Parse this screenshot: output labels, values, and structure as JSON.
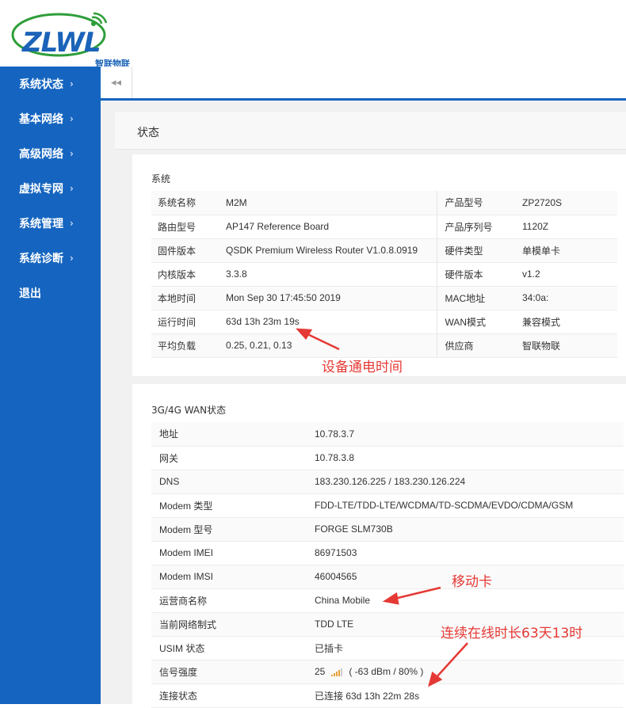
{
  "brand": {
    "logo_text": "ZLWL",
    "subtitle": "智联物联",
    "color": "#1a63b8"
  },
  "sidebar": {
    "color": "#1565c0",
    "items": [
      {
        "label": "系统状态",
        "icon": "chevron-right-icon"
      },
      {
        "label": "基本网络",
        "icon": "chevron-right-icon"
      },
      {
        "label": "高级网络",
        "icon": "chevron-right-icon"
      },
      {
        "label": "虚拟专网",
        "icon": "chevron-right-icon"
      },
      {
        "label": "系统管理",
        "icon": "chevron-right-icon"
      },
      {
        "label": "系统诊断",
        "icon": "chevron-right-icon"
      },
      {
        "label": "退出"
      }
    ]
  },
  "topbar": {
    "collapse_icon": "double-chevron-left-icon",
    "collapse_glyph": "◂◂"
  },
  "page": {
    "title": "状态"
  },
  "system": {
    "title": "系统",
    "left": [
      {
        "key": "系统名称",
        "value": "M2M"
      },
      {
        "key": "路由型号",
        "value": "AP147 Reference Board"
      },
      {
        "key": "固件版本",
        "value": "QSDK Premium Wireless Router V1.0.8.0919"
      },
      {
        "key": "内核版本",
        "value": "3.3.8"
      },
      {
        "key": "本地时间",
        "value": "Mon Sep 30 17:45:50 2019"
      },
      {
        "key": "运行时间",
        "value": "63d 13h 23m 19s"
      },
      {
        "key": "平均负载",
        "value": "0.25, 0.21, 0.13"
      }
    ],
    "right": [
      {
        "key": "产品型号",
        "value": "ZP2720S"
      },
      {
        "key": "产品序列号",
        "value": "1120Z"
      },
      {
        "key": "硬件类型",
        "value": "单模单卡"
      },
      {
        "key": "硬件版本",
        "value": "v1.2"
      },
      {
        "key": "MAC地址",
        "value": "34:0a:"
      },
      {
        "key": "WAN模式",
        "value": "兼容模式"
      },
      {
        "key": "供应商",
        "value": "智联物联"
      }
    ]
  },
  "wan": {
    "title": "3G/4G WAN状态",
    "rows": [
      {
        "key": "地址",
        "value": "10.78.3.7"
      },
      {
        "key": "网关",
        "value": "10.78.3.8"
      },
      {
        "key": "DNS",
        "value": "183.230.126.225 / 183.230.126.224"
      },
      {
        "key": "Modem 类型",
        "value": "FDD-LTE/TDD-LTE/WCDMA/TD-SCDMA/EVDO/CDMA/GSM"
      },
      {
        "key": "Modem 型号",
        "value": "FORGE SLM730B"
      },
      {
        "key": "Modem IMEI",
        "value": "86971503"
      },
      {
        "key": "Modem IMSI",
        "value": "46004565"
      },
      {
        "key": "运营商名称",
        "value": "China Mobile"
      },
      {
        "key": "当前网络制式",
        "value": "TDD LTE"
      },
      {
        "key": "USIM 状态",
        "value": "已插卡"
      },
      {
        "key": "信号强度",
        "value": "25",
        "signal_text": "( -63 dBm / 80% )",
        "signal_icon": "signal-bars-icon"
      },
      {
        "key": "连接状态",
        "value": "已连接 63d 13h 22m 28s"
      }
    ]
  },
  "annotations": {
    "uptime": "设备通电时间",
    "carrier": "移动卡",
    "online": "连续在线时长63天13时",
    "color": "#e53935"
  }
}
